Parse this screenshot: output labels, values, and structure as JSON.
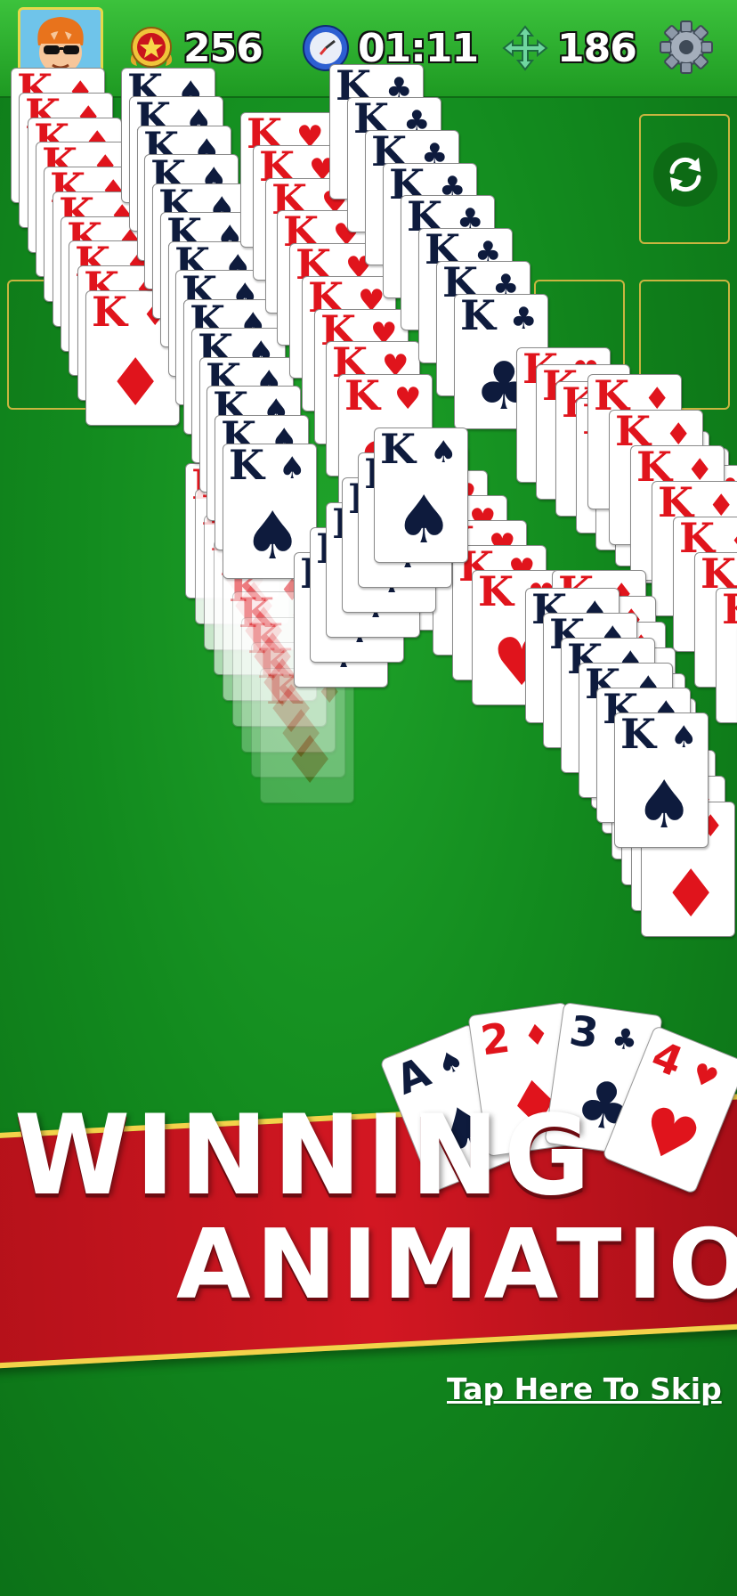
{
  "header": {
    "score": "256",
    "timer": "01:11",
    "moves": "186",
    "score_icon": "medal-star-icon",
    "timer_icon": "stopwatch-icon",
    "moves_icon": "move-arrows-icon",
    "settings_icon": "gear-icon",
    "avatar": "player-avatar"
  },
  "board": {
    "refresh_icon": "refresh-icon",
    "card_rank": "K",
    "suits": [
      "♦",
      "♠",
      "♥",
      "♣"
    ]
  },
  "promo": {
    "line1": "WINNING",
    "line2": "ANIMATIONS",
    "cards": [
      {
        "rank": "A",
        "suit": "♠"
      },
      {
        "rank": "2",
        "suit": "♦"
      },
      {
        "rank": "3",
        "suit": "♣"
      },
      {
        "rank": "4",
        "suit": "♥"
      }
    ]
  },
  "skip_label": "Tap Here To Skip",
  "colors": {
    "felt": "#128a1e",
    "banner_red": "#d21722",
    "gold": "#f3d24a",
    "card_red": "#e0141c",
    "card_black": "#0e1b3d"
  }
}
